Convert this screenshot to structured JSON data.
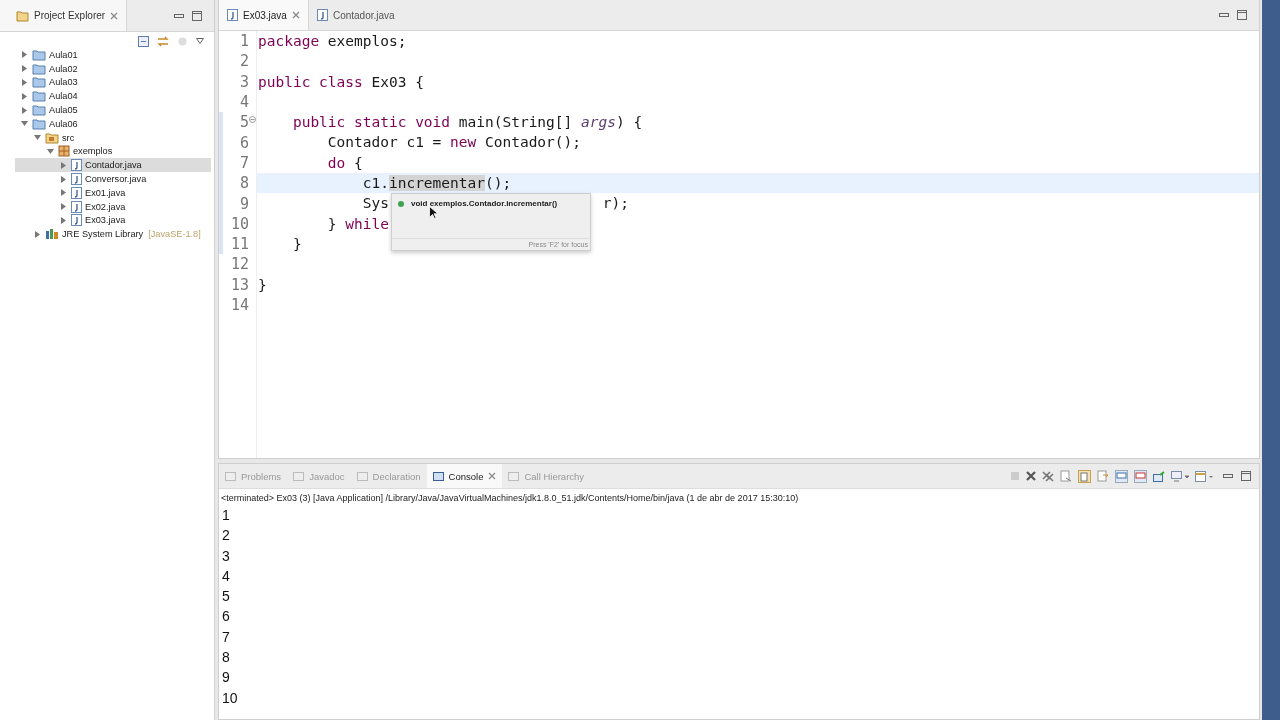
{
  "explorer": {
    "title": "Project Explorer",
    "tree": [
      {
        "label": "Aula01",
        "kind": "project",
        "expanded": false,
        "selected": false
      },
      {
        "label": "Aula02",
        "kind": "project",
        "expanded": false,
        "selected": false
      },
      {
        "label": "Aula03",
        "kind": "project",
        "expanded": false,
        "selected": false
      },
      {
        "label": "Aula04",
        "kind": "project",
        "expanded": false,
        "selected": false
      },
      {
        "label": "Aula05",
        "kind": "project",
        "expanded": false,
        "selected": false
      },
      {
        "label": "Aula06",
        "kind": "project",
        "expanded": true,
        "selected": false,
        "children": [
          {
            "label": "src",
            "kind": "source",
            "expanded": true,
            "selected": false,
            "children": [
              {
                "label": "exemplos",
                "kind": "package",
                "expanded": true,
                "selected": false,
                "children": [
                  {
                    "label": "Contador.java",
                    "kind": "file",
                    "expanded": false,
                    "selected": true
                  },
                  {
                    "label": "Conversor.java",
                    "kind": "file",
                    "expanded": false,
                    "selected": false
                  },
                  {
                    "label": "Ex01.java",
                    "kind": "file",
                    "expanded": false,
                    "selected": false
                  },
                  {
                    "label": "Ex02.java",
                    "kind": "file",
                    "expanded": false,
                    "selected": false
                  },
                  {
                    "label": "Ex03.java",
                    "kind": "file",
                    "expanded": false,
                    "selected": false
                  }
                ]
              }
            ]
          },
          {
            "label": "JRE System Library",
            "suffix": "[JavaSE-1.8]",
            "kind": "library",
            "expanded": false,
            "selected": false
          }
        ]
      }
    ]
  },
  "editor": {
    "tabs": [
      {
        "label": "Ex03.java",
        "selected": true
      },
      {
        "label": "Contador.java",
        "selected": false
      }
    ],
    "lines": [
      {
        "number": "1",
        "tokens": [
          {
            "kind": "keyword",
            "text": "package"
          },
          {
            "kind": "plain",
            "text": " exemplos;"
          }
        ]
      },
      {
        "number": "2"
      },
      {
        "number": "3",
        "tokens": [
          {
            "kind": "keyword",
            "text": "public class"
          },
          {
            "kind": "plain",
            "text": " Ex03 {"
          }
        ]
      },
      {
        "number": "4"
      },
      {
        "number": "5",
        "fold": true,
        "tokens": [
          {
            "kind": "keyword",
            "text": "    public static void"
          },
          {
            "kind": "plain",
            "text": " main(String[] "
          },
          {
            "kind": "param",
            "text": "args"
          },
          {
            "kind": "plain",
            "text": ") {"
          }
        ]
      },
      {
        "number": "6",
        "tokens": [
          {
            "kind": "plain",
            "text": "        Contador c1 = "
          },
          {
            "kind": "keyword",
            "text": "new"
          },
          {
            "kind": "plain",
            "text": " Contador();"
          }
        ]
      },
      {
        "number": "7",
        "tokens": [
          {
            "kind": "keyword",
            "text": "        do"
          },
          {
            "kind": "plain",
            "text": " {"
          }
        ]
      },
      {
        "number": "8",
        "current": true,
        "tokens": [
          {
            "kind": "plain",
            "text": "            c1."
          },
          {
            "kind": "occurrence",
            "text": "incrementar"
          },
          {
            "kind": "plain",
            "text": "();"
          }
        ]
      },
      {
        "number": "9",
        "tokens": [
          {
            "kind": "plain",
            "text": "            Sys"
          },
          {
            "kind": "resume",
            "text": "r"
          },
          {
            "kind": "plain",
            "text": ");"
          }
        ]
      },
      {
        "number": "10",
        "tokens": [
          {
            "kind": "plain",
            "text": "        } "
          },
          {
            "kind": "keyword",
            "text": "while"
          }
        ]
      },
      {
        "number": "11",
        "tokens": [
          {
            "kind": "plain",
            "text": "    }"
          }
        ]
      },
      {
        "number": "12"
      },
      {
        "number": "13",
        "tokens": [
          {
            "kind": "plain",
            "text": "}"
          }
        ]
      },
      {
        "number": "14"
      }
    ],
    "hover": {
      "signature": "void exemplos.Contador.incrementar()",
      "footer": "Press 'F2' for focus"
    }
  },
  "console": {
    "tabs": [
      {
        "label": "Problems",
        "selected": false
      },
      {
        "label": "Javadoc",
        "selected": false
      },
      {
        "label": "Declaration",
        "selected": false
      },
      {
        "label": "Console",
        "selected": true
      },
      {
        "label": "Call Hierarchy",
        "selected": false
      }
    ],
    "status": "<terminated> Ex03 (3) [Java Application] /Library/Java/JavaVirtualMachines/jdk1.8.0_51.jdk/Contents/Home/bin/java (1 de abr de 2017 15:30:10)",
    "output": [
      "1",
      "2",
      "3",
      "4",
      "5",
      "6",
      "7",
      "8",
      "9",
      "10"
    ]
  }
}
